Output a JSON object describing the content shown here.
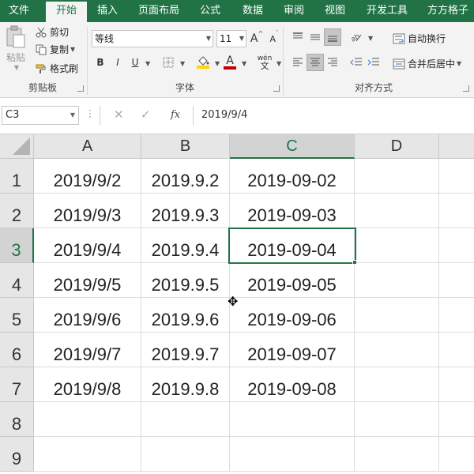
{
  "tabs": [
    "文件",
    "开始",
    "插入",
    "页面布局",
    "公式",
    "数据",
    "审阅",
    "视图",
    "开发工具",
    "方方格子"
  ],
  "active_tab": "开始",
  "clipboard": {
    "paste_label": "粘贴",
    "cut_label": "剪切",
    "copy_label": "复制",
    "format_painter_label": "格式刷",
    "group_label": "剪贴板"
  },
  "font": {
    "font_name": "等线",
    "font_size": "11",
    "grow_label": "A",
    "shrink_label": "A",
    "bold_label": "B",
    "italic_label": "I",
    "underline_label": "U",
    "font_color_label": "A",
    "phonetic_label": "wén",
    "group_label": "字体"
  },
  "alignment": {
    "wrap_text_label": "自动换行",
    "merge_center_label": "合并后居中",
    "group_label": "对齐方式"
  },
  "formula_bar": {
    "name_box": "C3",
    "fx_label": "fx",
    "content": "2019/9/4"
  },
  "grid": {
    "columns": [
      "A",
      "B",
      "C",
      "D"
    ],
    "selected_column": "C",
    "selected_row": "3",
    "rows": [
      {
        "num": "1",
        "cells": [
          "2019/9/2",
          "2019.9.2",
          "2019-09-02",
          ""
        ]
      },
      {
        "num": "2",
        "cells": [
          "2019/9/3",
          "2019.9.3",
          "2019-09-03",
          ""
        ]
      },
      {
        "num": "3",
        "cells": [
          "2019/9/4",
          "2019.9.4",
          "2019-09-04",
          ""
        ]
      },
      {
        "num": "4",
        "cells": [
          "2019/9/5",
          "2019.9.5",
          "2019-09-05",
          ""
        ]
      },
      {
        "num": "5",
        "cells": [
          "2019/9/6",
          "2019.9.6",
          "2019-09-06",
          ""
        ]
      },
      {
        "num": "6",
        "cells": [
          "2019/9/7",
          "2019.9.7",
          "2019-09-07",
          ""
        ]
      },
      {
        "num": "7",
        "cells": [
          "2019/9/8",
          "2019.9.8",
          "2019-09-08",
          ""
        ]
      },
      {
        "num": "8",
        "cells": [
          "",
          "",
          "",
          ""
        ]
      },
      {
        "num": "9",
        "cells": [
          "",
          "",
          "",
          ""
        ]
      }
    ]
  },
  "colors": {
    "accent": "#217346",
    "font_color_bar": "#c00000",
    "fill_color_bar": "#ffd700"
  }
}
